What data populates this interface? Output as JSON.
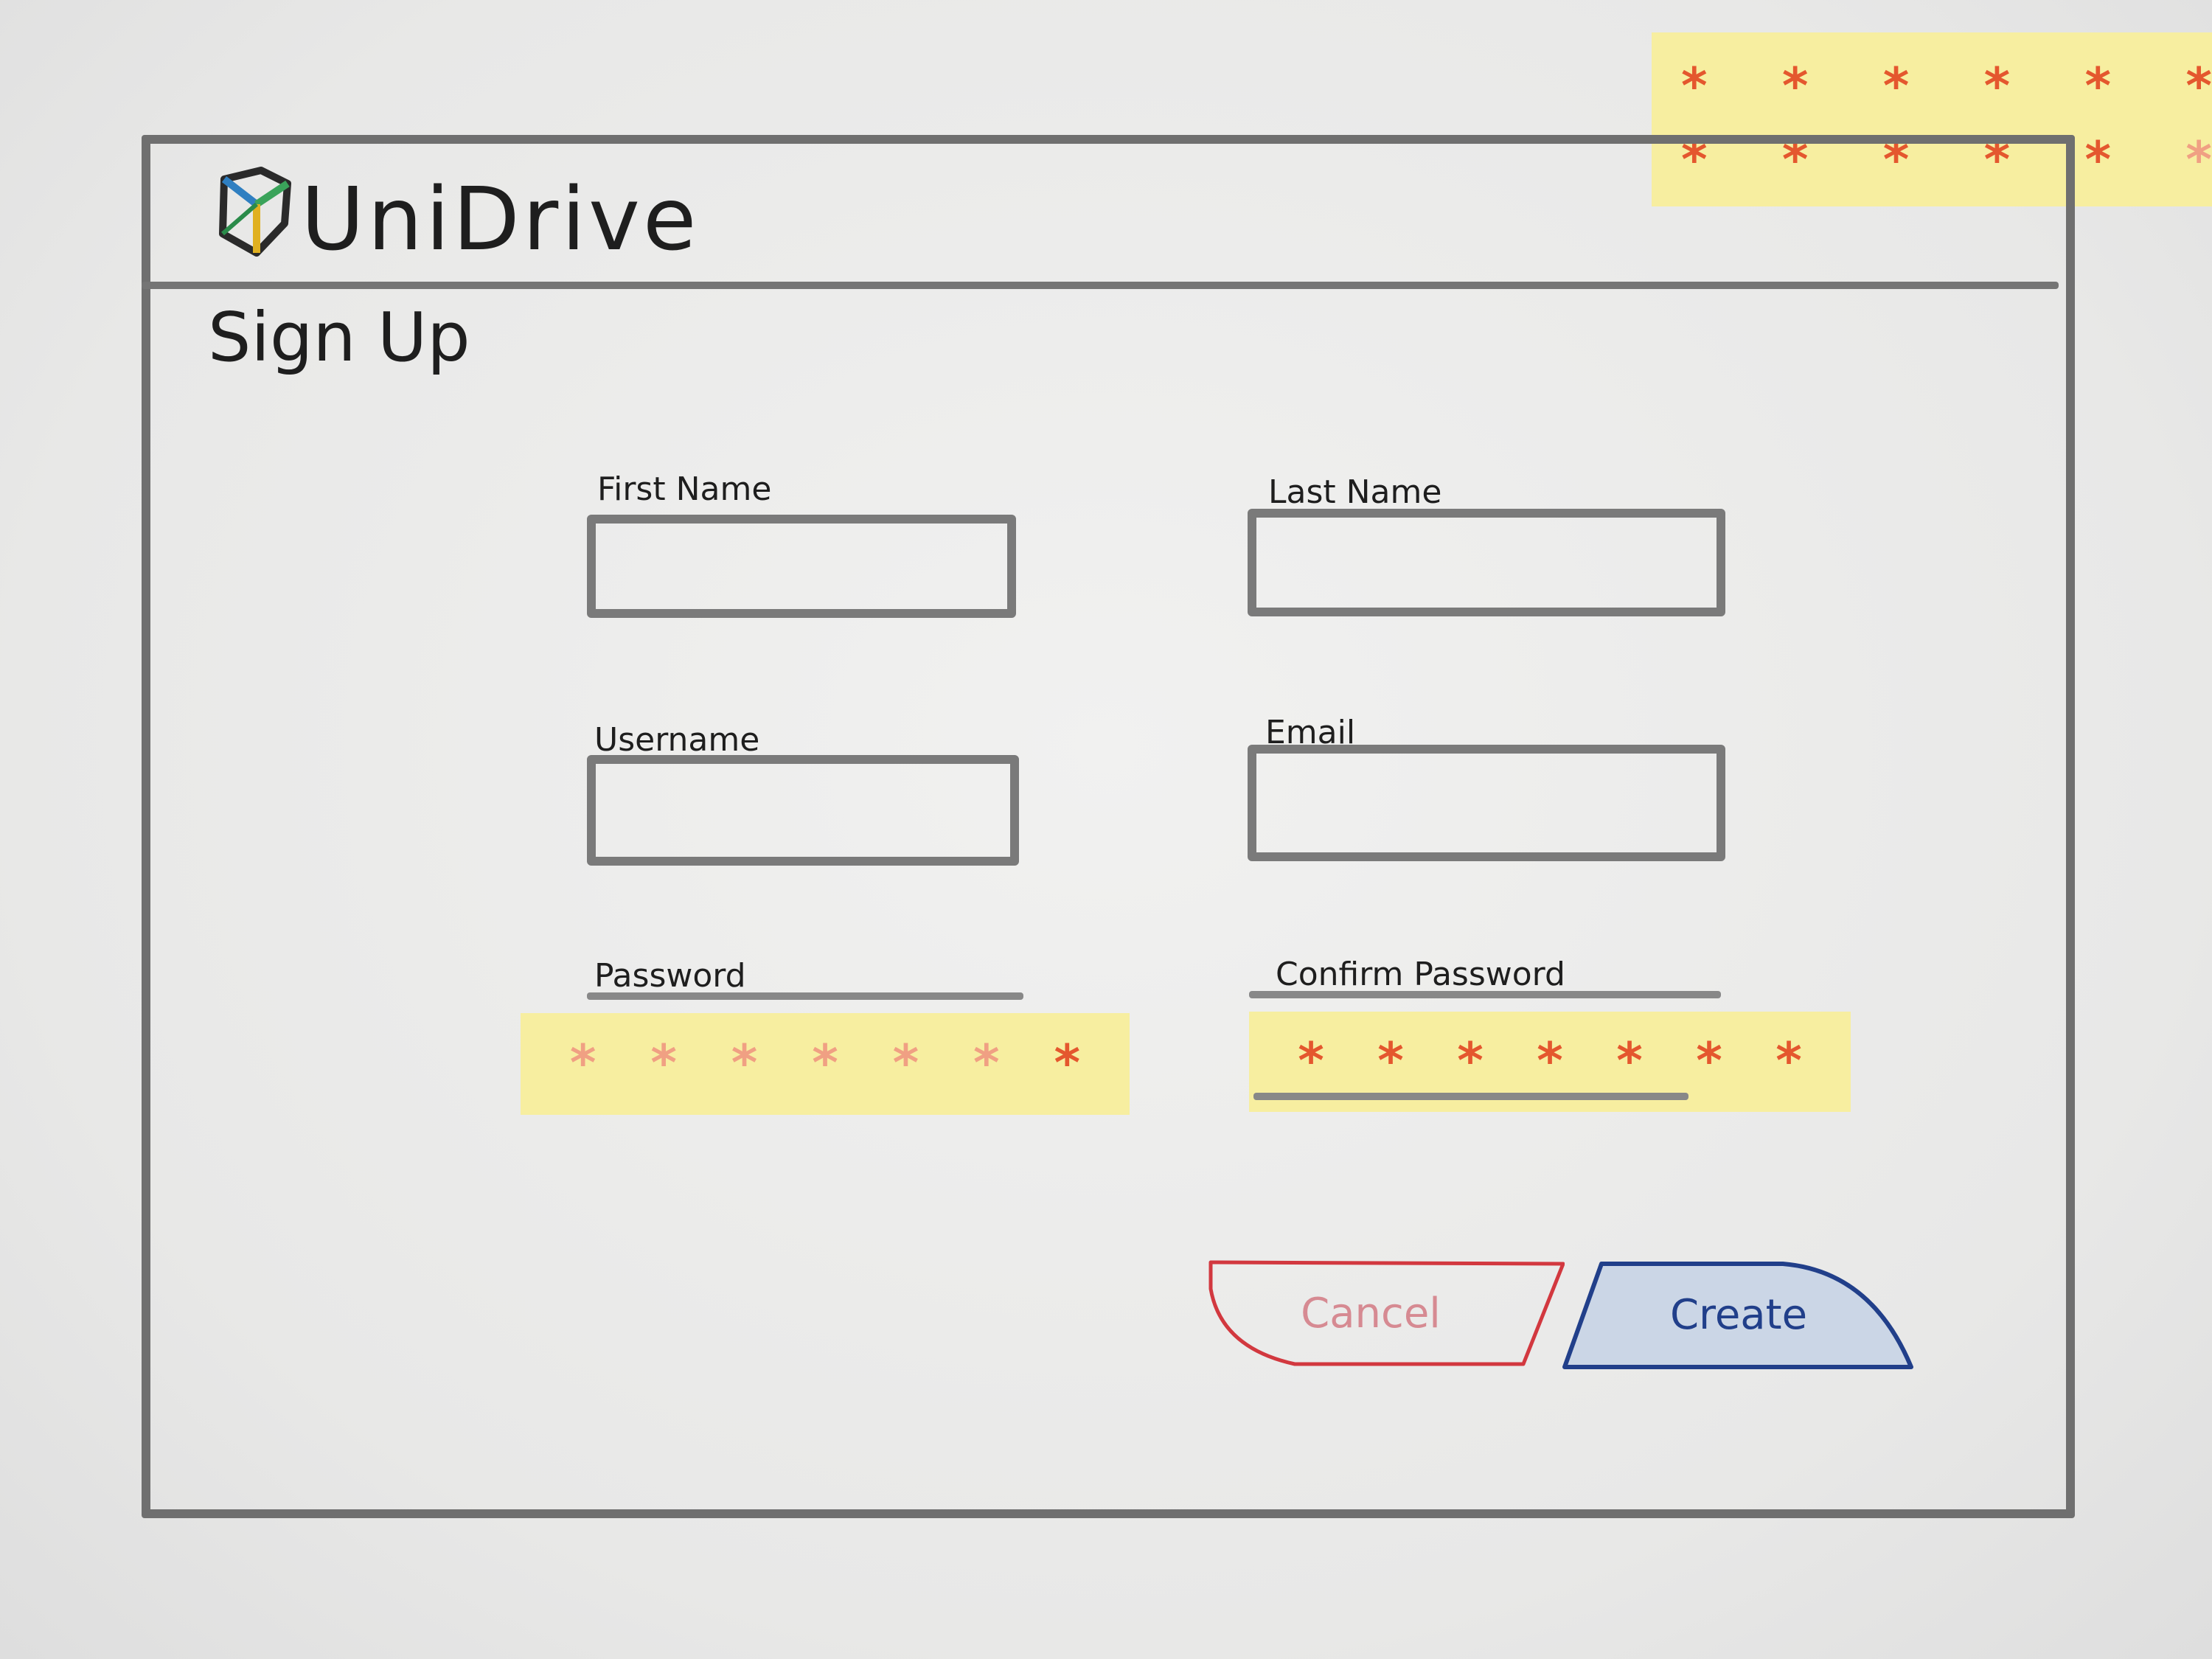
{
  "app": {
    "name": "UniDrive",
    "logo_icon": "cube-logo-icon"
  },
  "page": {
    "title": "Sign Up"
  },
  "form": {
    "first_name": {
      "label": "First Name",
      "value": ""
    },
    "last_name": {
      "label": "Last Name",
      "value": ""
    },
    "username": {
      "label": "Username",
      "value": ""
    },
    "email": {
      "label": "Email",
      "value": ""
    },
    "password": {
      "label": "Password",
      "value": "*******"
    },
    "confirm_password": {
      "label": "Confirm Password",
      "value": "*******"
    }
  },
  "top_note": {
    "row1": "******",
    "row2": "******"
  },
  "buttons": {
    "cancel_label": "Cancel",
    "create_label": "Create"
  },
  "colors": {
    "sticky_note": "#f7eea0",
    "password_star": "#e4572e",
    "cancel_outline": "#d2383f",
    "create_outline": "#213f8a",
    "create_fill": "#cbd6e6"
  }
}
